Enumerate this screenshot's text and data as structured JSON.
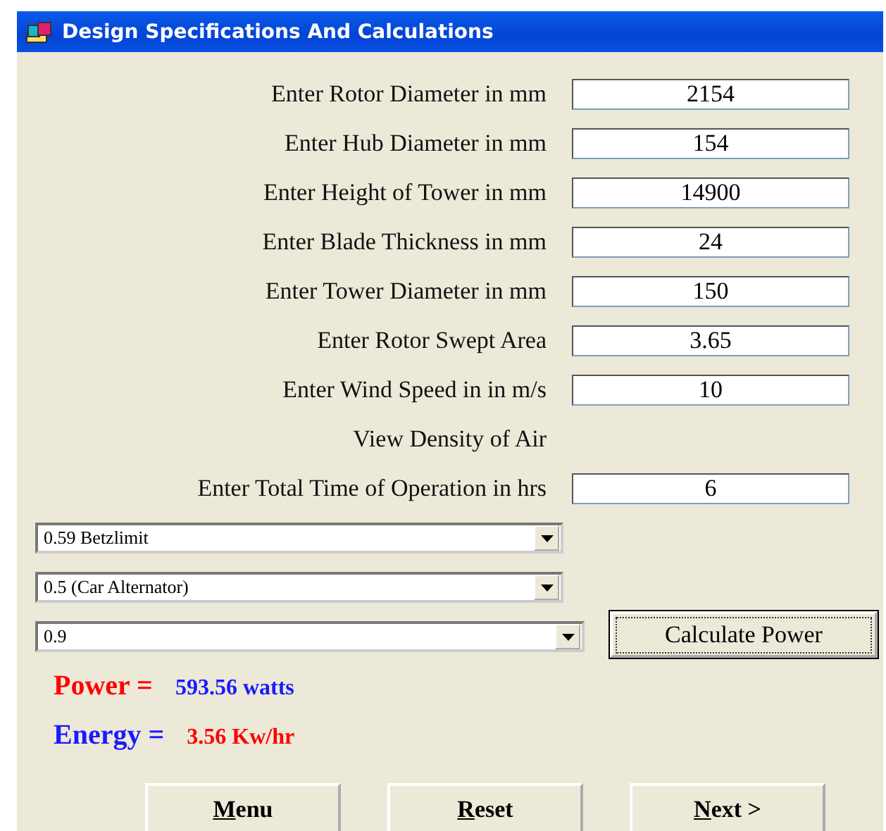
{
  "window": {
    "title": "Design Specifications And Calculations"
  },
  "fields": [
    {
      "label": "Enter Rotor Diameter in mm",
      "value": "2154"
    },
    {
      "label": "Enter Hub Diameter in mm",
      "value": "154"
    },
    {
      "label": "Enter Height of Tower in mm",
      "value": "14900"
    },
    {
      "label": "Enter Blade Thickness in mm",
      "value": "24"
    },
    {
      "label": "Enter Tower Diameter in mm",
      "value": "150"
    },
    {
      "label": "Enter Rotor Swept Area",
      "value": "3.65"
    },
    {
      "label": "Enter Wind Speed in  in m/s",
      "value": "10"
    },
    {
      "label": "View Density of Air"
    },
    {
      "label": "Enter Total Time of Operation in hrs",
      "value": "6"
    }
  ],
  "dropdowns": [
    {
      "value": "0.59 Betzlimit"
    },
    {
      "value": "0.5 (Car Alternator)"
    },
    {
      "value": "0.9"
    }
  ],
  "calculate_button": "Calculate Power",
  "results": [
    {
      "label": {
        "text": "Power =",
        "color": "#ff0000"
      },
      "value": {
        "text": "593.56 watts",
        "color": "#1a1aff"
      }
    },
    {
      "label": {
        "text": "Energy =",
        "color": "#1a1aff"
      },
      "value": {
        "text": "3.56 Kw/hr",
        "color": "#ff0000"
      }
    }
  ],
  "buttons": [
    "Menu",
    "Reset",
    "Next >"
  ]
}
